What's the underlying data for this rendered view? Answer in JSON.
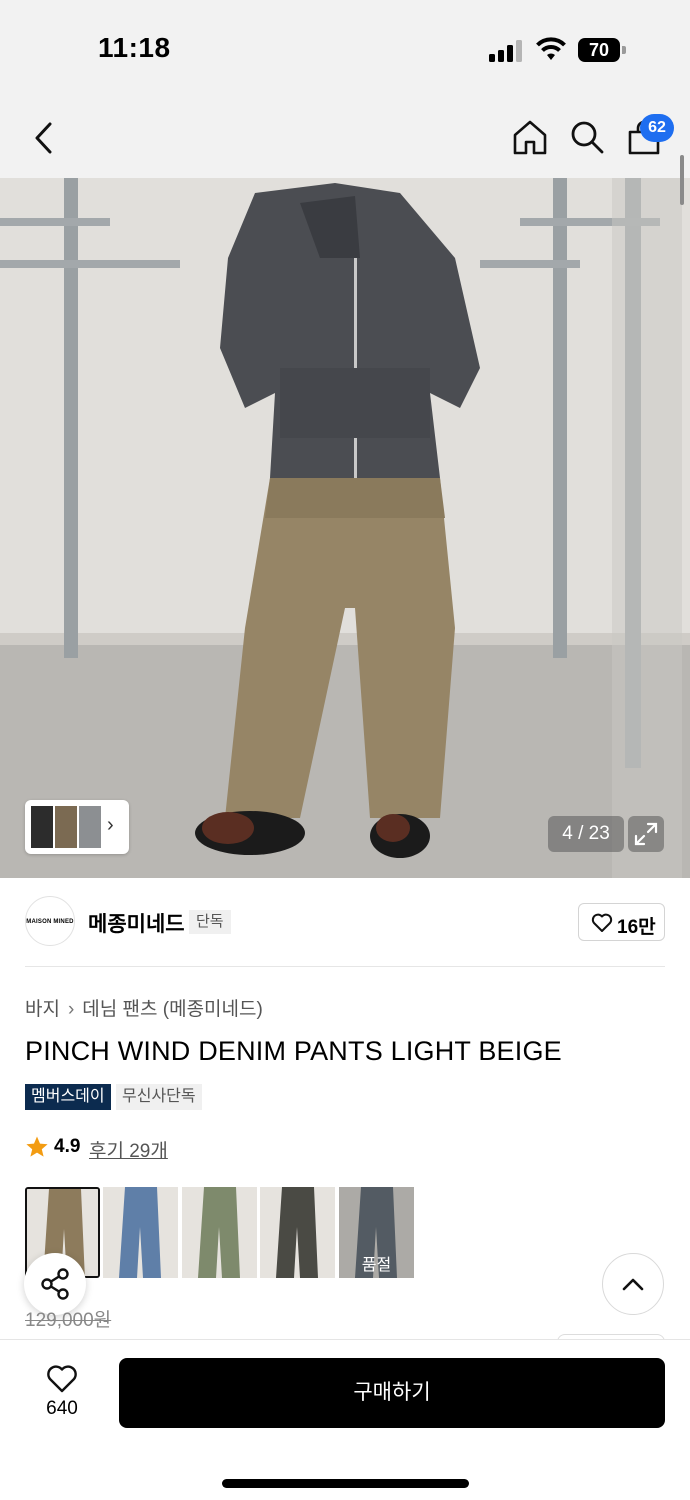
{
  "status_bar": {
    "time": "11:18",
    "battery": "70"
  },
  "nav": {
    "cart_badge": "62",
    "icons": [
      "back-icon",
      "home-icon",
      "search-icon",
      "cart-icon"
    ]
  },
  "hero": {
    "counter": "4 / 23"
  },
  "brand": {
    "logo_text": "MAISON MINED",
    "name": "메종미네드",
    "exclusive_tag": "단독",
    "likes": "16만"
  },
  "breadcrumb": {
    "category": "바지",
    "subcategory": "데님 팬츠 (메종미네드)"
  },
  "product": {
    "title": "PINCH WIND DENIM PANTS LIGHT BEIGE",
    "tags": [
      "멤버스데이",
      "무신사단독"
    ],
    "rating": "4.9",
    "reviews": "후기 29개",
    "original_price": "129,000원"
  },
  "variants": [
    {
      "color": "#8d7b5c",
      "selected": true
    },
    {
      "color": "#5f7fa8"
    },
    {
      "color": "#7e8a6c"
    },
    {
      "color": "#4a4a44"
    },
    {
      "color": "#6f7a84",
      "status": "품절"
    }
  ],
  "bottom": {
    "wish_count": "640",
    "buy_label": "구매하기"
  },
  "colors": {
    "accent_blue": "#1e6ef0",
    "member_tag_bg": "#0c2b4f",
    "star": "#f39c12"
  }
}
